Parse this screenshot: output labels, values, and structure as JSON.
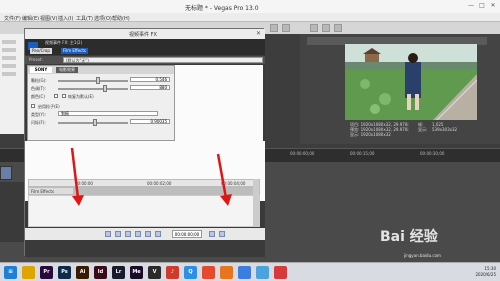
{
  "app": {
    "window_title": "无标题 * - Vegas Pro 13.0",
    "menu": [
      "文件(F)",
      "编辑(E)",
      "视图(V)",
      "插入(I)",
      "工具(T)",
      "选项(O)",
      "帮助(H)"
    ]
  },
  "dialog": {
    "title": "视频事件 FX",
    "chain_text": "视频事件 FX: 主1(2)",
    "plugins": [
      "Pan/Crop",
      "Film Effects"
    ],
    "preset_label": "Preset:",
    "preset_value": "(默认为\"无\")",
    "fx_brand": "SONY",
    "fx_name": "电影效果",
    "params": [
      {
        "label": "颗粒(G):",
        "value": "0.546",
        "level": 0.55
      },
      {
        "label": "色调(T):",
        "value": "880",
        "level": 0.65
      },
      {
        "label": "颜色(C)",
        "value": "",
        "level": 0.0
      },
      {
        "label": "闪烁(F):",
        "value": "0.90035",
        "level": 0.5
      }
    ],
    "color_check_label": "恢复为默认(E)",
    "effect_check_label": "启用粒子(E)",
    "type_label": "类型(Y):",
    "type_value": "划痕",
    "kf_ruler": [
      "00:00:00",
      "00:00:02;00",
      "00:00:04;00"
    ],
    "kf_track": "Film Effects",
    "timecode": "00:00:00;00"
  },
  "preview": {
    "info_lines": [
      "项目: 1920x1080x32, 29.970i",
      "预览: 1920x1080x32, 29.970i",
      "显示: 1920x1080x32"
    ],
    "info_right": [
      "帧:",
      "显示:"
    ],
    "info_right_vals": [
      "1,025",
      "539x303x32"
    ]
  },
  "ruler": [
    "00:00:00;00",
    "00:00:15;00",
    "00:00:30;00"
  ],
  "taskbar": {
    "icons": [
      {
        "name": "windows",
        "label": "⊞",
        "color": "#1e7fd6"
      },
      {
        "name": "explorer",
        "label": "",
        "color": "#e0a400"
      },
      {
        "name": "premiere",
        "label": "Pr",
        "color": "#2a0a3a"
      },
      {
        "name": "photoshop",
        "label": "Ps",
        "color": "#0d2a4a"
      },
      {
        "name": "illustrator",
        "label": "Ai",
        "color": "#3a1a00"
      },
      {
        "name": "indesign",
        "label": "Id",
        "color": "#3a0a1a"
      },
      {
        "name": "lightroom",
        "label": "Lr",
        "color": "#1a1a2e"
      },
      {
        "name": "media-encoder",
        "label": "Me",
        "color": "#1a0a2a"
      },
      {
        "name": "vegas",
        "label": "V",
        "color": "#2a2a2a"
      },
      {
        "name": "music",
        "label": "♪",
        "color": "#cf3a2a"
      },
      {
        "name": "qq",
        "label": "Q",
        "color": "#2d8ee6"
      },
      {
        "name": "chrome",
        "label": "",
        "color": "#e64a2e"
      },
      {
        "name": "firefox",
        "label": "",
        "color": "#e8741e"
      },
      {
        "name": "app-a",
        "label": "",
        "color": "#3b7de0"
      },
      {
        "name": "app-b",
        "label": "",
        "color": "#4aa3df"
      },
      {
        "name": "app-c",
        "label": "",
        "color": "#d63a3a"
      }
    ],
    "time": "15:30",
    "date": "2020/6/25"
  },
  "watermark": {
    "main": "Bai 经验",
    "sub": "jingyan.baidu.com"
  }
}
